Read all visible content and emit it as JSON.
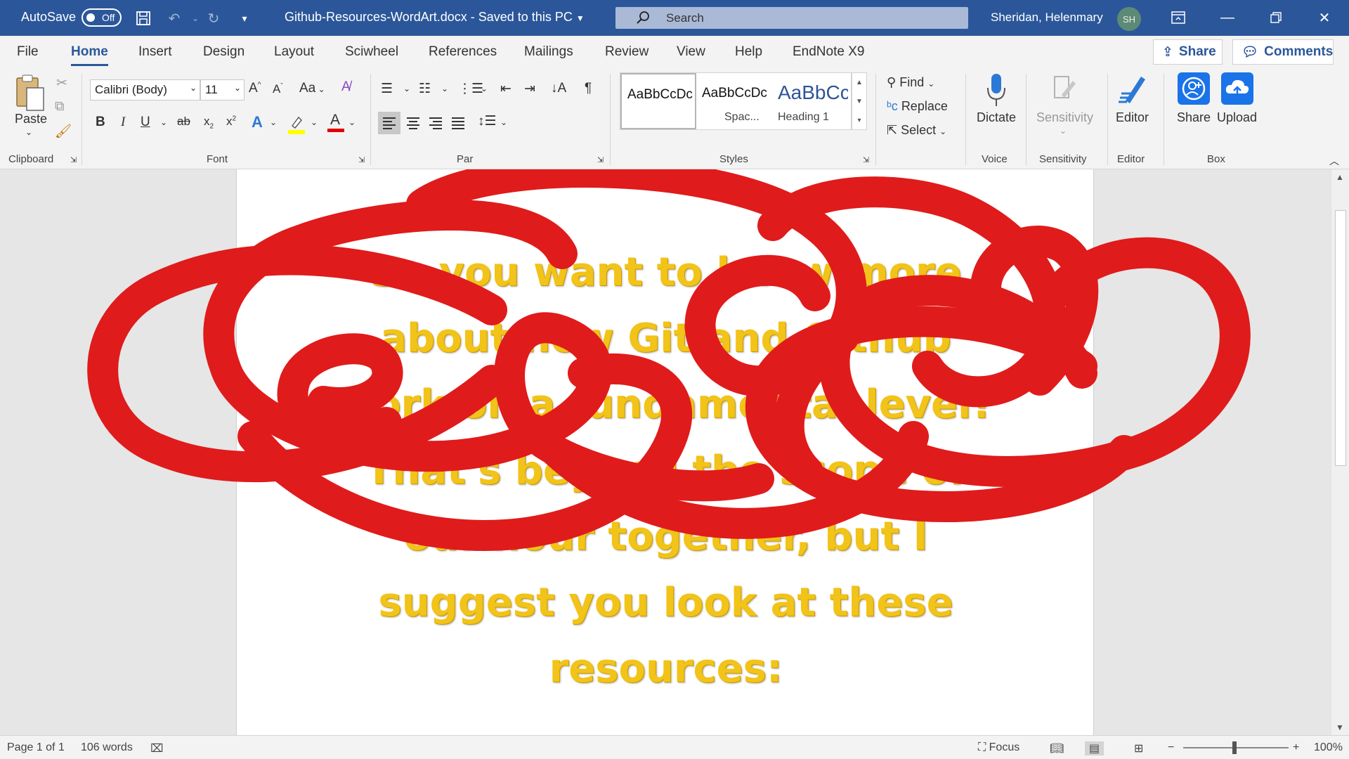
{
  "titlebar": {
    "autosave_label": "AutoSave",
    "autosave_state": "Off",
    "document_title": "Github-Resources-WordArt.docx  -  Saved to this PC",
    "search_placeholder": "Search",
    "user_name": "Sheridan, Helenmary",
    "user_initials": "SH"
  },
  "tabs": [
    "File",
    "Home",
    "Insert",
    "Design",
    "Layout",
    "Sciwheel",
    "References",
    "Mailings",
    "Review",
    "View",
    "Help",
    "EndNote X9"
  ],
  "active_tab": "Home",
  "share_label": "Share",
  "comments_label": "Comments",
  "ribbon": {
    "clipboard": {
      "paste": "Paste",
      "group": "Clipboard"
    },
    "font": {
      "name": "Calibri (Body)",
      "size": "11",
      "change_case": "Aa",
      "group": "Font"
    },
    "paragraph": {
      "group": "Par"
    },
    "styles": {
      "group": "Styles",
      "items": [
        {
          "sample": "AaBbCcDc",
          "name": ""
        },
        {
          "sample": "AaBbCcDc",
          "name": "Spac..."
        },
        {
          "sample": "AaBbCc",
          "name": "Heading 1"
        }
      ]
    },
    "editing": {
      "find": "Find",
      "replace": "Replace",
      "select": "Select"
    },
    "voice": {
      "dictate": "Dictate",
      "group": "Voice"
    },
    "sensitivity": {
      "label": "Sensitivity",
      "group": "Sensitivity"
    },
    "editor": {
      "label": "Editor",
      "group": "Editor"
    },
    "box": {
      "share": "Share",
      "upload": "Upload",
      "group": "Box"
    }
  },
  "document": {
    "lines": [
      "So you want to know more",
      "about how Git and Github",
      "work on a fundamental level?",
      "That's beyond the scope of",
      "our hour together, but I",
      "suggest you look at these",
      "resources:"
    ],
    "wordart_color": "#f2c318",
    "scribble_color": "#e01b1b"
  },
  "status": {
    "page": "Page 1 of 1",
    "words": "106 words",
    "focus": "Focus",
    "zoom": "100%"
  }
}
